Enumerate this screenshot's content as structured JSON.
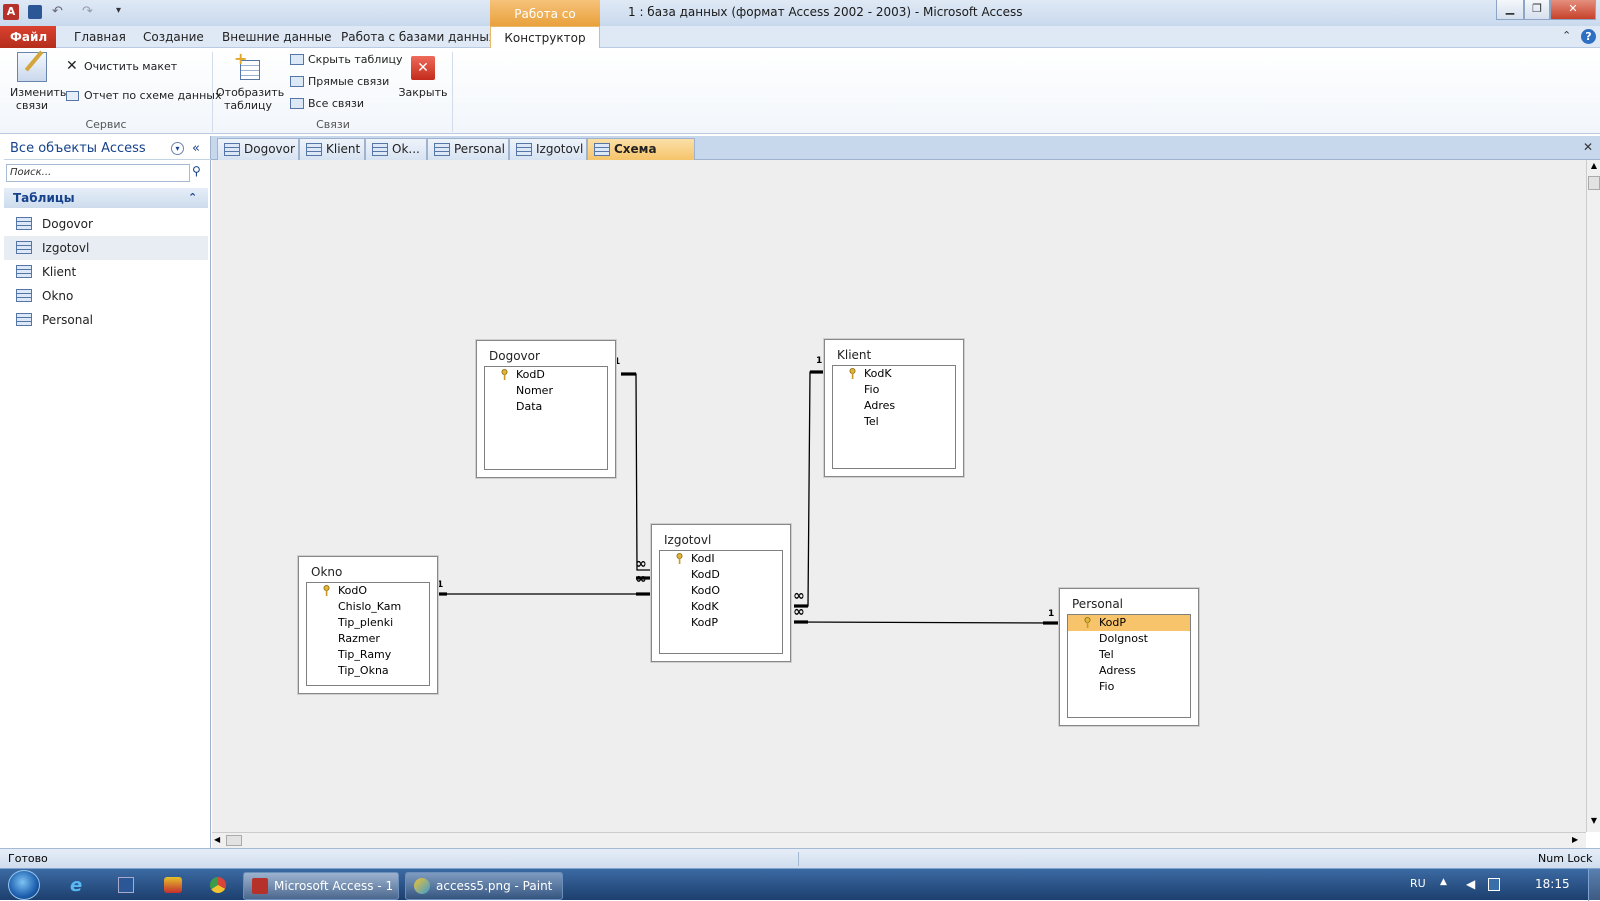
{
  "window": {
    "title": "1 : база данных (формат Access 2002 - 2003)  -  Microsoft Access",
    "context_tab": "Работа со связями"
  },
  "ribbon_tabs": [
    "Файл",
    "Главная",
    "Создание",
    "Внешние данные",
    "Работа с базами данных",
    "Конструктор"
  ],
  "ribbon": {
    "edit_relations": "Изменить связи",
    "clear_layout": "Очистить макет",
    "report": "Отчет по схеме данных",
    "group_service": "Сервис",
    "show_table": "Отобразить таблицу",
    "hide_table": "Скрыть таблицу",
    "direct_relations": "Прямые связи",
    "all_relations": "Все связи",
    "group_relations": "Связи",
    "close": "Закрыть"
  },
  "nav": {
    "header": "Все объекты Access",
    "search_placeholder": "Поиск...",
    "section": "Таблицы",
    "items": [
      "Dogovor",
      "Izgotovl",
      "Klient",
      "Okno",
      "Personal"
    ]
  },
  "doc_tabs": [
    "Dogovor",
    "Klient",
    "Ok...",
    "Personal",
    "Izgotovl",
    "Схема данных"
  ],
  "tables": {
    "dogovor": {
      "title": "Dogovor",
      "fields": [
        "KodD",
        "Nomer",
        "Data"
      ]
    },
    "klient": {
      "title": "Klient",
      "fields": [
        "KodK",
        "Fio",
        "Adres",
        "Tel"
      ]
    },
    "okno": {
      "title": "Okno",
      "fields": [
        "KodO",
        "Chislo_Kam",
        "Tip_plenki",
        "Razmer",
        "Tip_Ramy",
        "Tip_Okna"
      ]
    },
    "izgotovl": {
      "title": "Izgotovl",
      "fields": [
        "KodI",
        "KodD",
        "KodO",
        "KodK",
        "KodP"
      ]
    },
    "personal": {
      "title": "Personal",
      "fields": [
        "KodP",
        "Dolgnost",
        "Tel",
        "Adress",
        "Fio"
      ]
    }
  },
  "relations": {
    "one": "1",
    "many": "∞"
  },
  "status": {
    "left": "Готово",
    "right": "Num Lock"
  },
  "taskbar": {
    "apps": [
      "Microsoft Access - 1 ...",
      "access5.png - Paint"
    ],
    "lang": "RU",
    "time": "18:15"
  },
  "colors": {
    "accent": "#f8c46b",
    "file_tab": "#c2372a",
    "ribbon_text": "#15428b"
  }
}
